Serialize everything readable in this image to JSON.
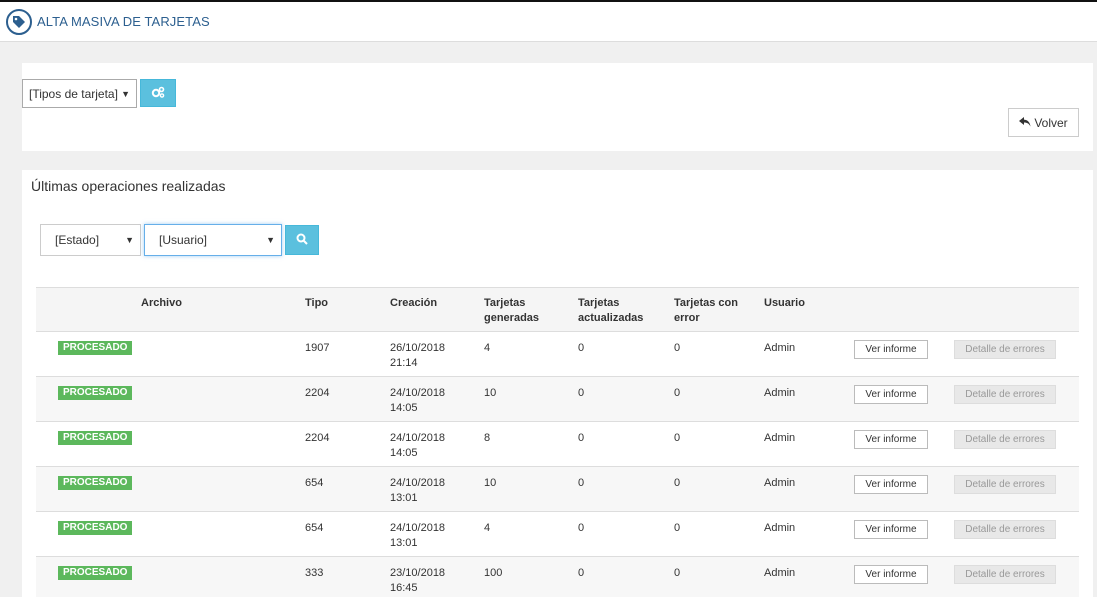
{
  "header": {
    "title": "ALTA MASIVA DE TARJETAS",
    "icon": "tag-icon"
  },
  "toolbar": {
    "card_type_select": "[Tipos de tarjeta]",
    "config_button_icon": "cogs-icon",
    "back_button_label": "Volver",
    "back_button_icon": "reply-icon"
  },
  "operations": {
    "title": "Últimas operaciones realizadas",
    "status_filter": "[Estado]",
    "user_filter": "[Usuario]",
    "search_icon": "search-icon",
    "columns": {
      "archivo": "Archivo",
      "tipo": "Tipo",
      "creacion": "Creación",
      "generadas_1": "Tarjetas",
      "generadas_2": "generadas",
      "actualizadas_1": "Tarjetas",
      "actualizadas_2": "actualizadas",
      "error_1": "Tarjetas con",
      "error_2": "error",
      "usuario": "Usuario"
    },
    "rows": [
      {
        "status": "PROCESADO",
        "tipo": "1907",
        "fecha": "26/10/2018",
        "hora": "21:14",
        "generadas": "4",
        "actualizadas": "0",
        "error": "0",
        "usuario": "Admin",
        "ver": "Ver informe",
        "detalle": "Detalle de errores"
      },
      {
        "status": "PROCESADO",
        "tipo": "2204",
        "fecha": "24/10/2018",
        "hora": "14:05",
        "generadas": "10",
        "actualizadas": "0",
        "error": "0",
        "usuario": "Admin",
        "ver": "Ver informe",
        "detalle": "Detalle de errores"
      },
      {
        "status": "PROCESADO",
        "tipo": "2204",
        "fecha": "24/10/2018",
        "hora": "14:05",
        "generadas": "8",
        "actualizadas": "0",
        "error": "0",
        "usuario": "Admin",
        "ver": "Ver informe",
        "detalle": "Detalle de errores"
      },
      {
        "status": "PROCESADO",
        "tipo": "654",
        "fecha": "24/10/2018",
        "hora": "13:01",
        "generadas": "10",
        "actualizadas": "0",
        "error": "0",
        "usuario": "Admin",
        "ver": "Ver informe",
        "detalle": "Detalle de errores"
      },
      {
        "status": "PROCESADO",
        "tipo": "654",
        "fecha": "24/10/2018",
        "hora": "13:01",
        "generadas": "4",
        "actualizadas": "0",
        "error": "0",
        "usuario": "Admin",
        "ver": "Ver informe",
        "detalle": "Detalle de errores"
      },
      {
        "status": "PROCESADO",
        "tipo": "333",
        "fecha": "23/10/2018",
        "hora": "16:45",
        "generadas": "100",
        "actualizadas": "0",
        "error": "0",
        "usuario": "Admin",
        "ver": "Ver informe",
        "detalle": "Detalle de errores"
      }
    ]
  },
  "colors": {
    "primary": "#2c5f8f",
    "info": "#5bc0de",
    "success": "#5cb85c"
  }
}
